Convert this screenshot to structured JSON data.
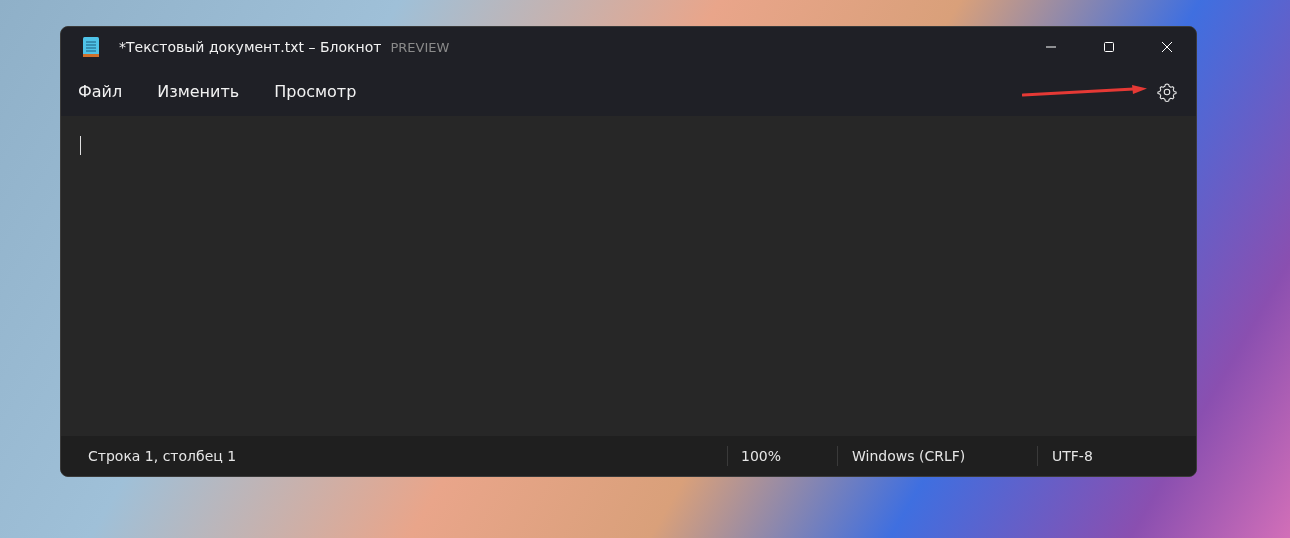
{
  "window": {
    "title": "*Текстовый документ.txt – Блокнот",
    "badge": "PREVIEW"
  },
  "menu": [
    {
      "label": "Файл"
    },
    {
      "label": "Изменить"
    },
    {
      "label": "Просмотр"
    }
  ],
  "status_bar": [
    {
      "text": "Строка 1, столбец 1"
    },
    {
      "text": "100%"
    },
    {
      "text": "Windows (CRLF)"
    },
    {
      "text": "UTF-8"
    }
  ]
}
